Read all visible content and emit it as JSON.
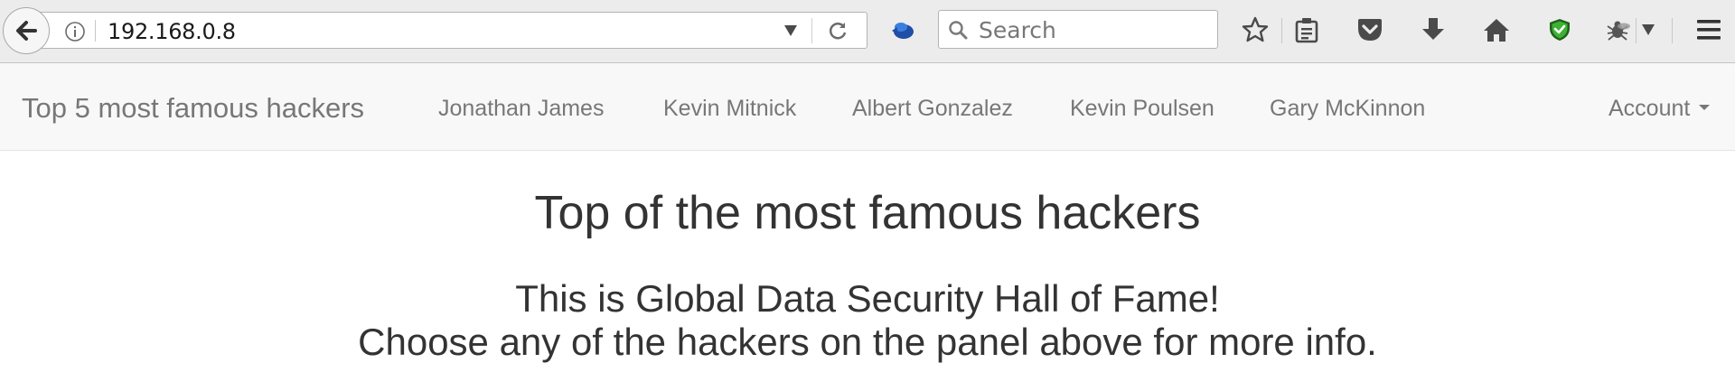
{
  "browser": {
    "url": "192.168.0.8",
    "search_placeholder": "Search",
    "icons": [
      "back-arrow-icon",
      "info-icon",
      "dropmarker-icon",
      "reload-icon",
      "extension-icon",
      "search-icon",
      "bookmark-star-icon",
      "reading-list-icon",
      "pocket-icon",
      "download-icon",
      "home-icon",
      "shield-icon",
      "bug-icon",
      "menu-icon"
    ],
    "shield_color": "#3cb133"
  },
  "navbar": {
    "brand": "Top 5 most famous hackers",
    "links": [
      "Jonathan James",
      "Kevin Mitnick",
      "Albert Gonzalez",
      "Kevin Poulsen",
      "Gary McKinnon"
    ],
    "account": "Account"
  },
  "main": {
    "heading": "Top of the most famous hackers",
    "intro_line1": "This is Global Data Security Hall of Fame!",
    "intro_line2": "Choose any of the hackers on the panel above for more info."
  }
}
